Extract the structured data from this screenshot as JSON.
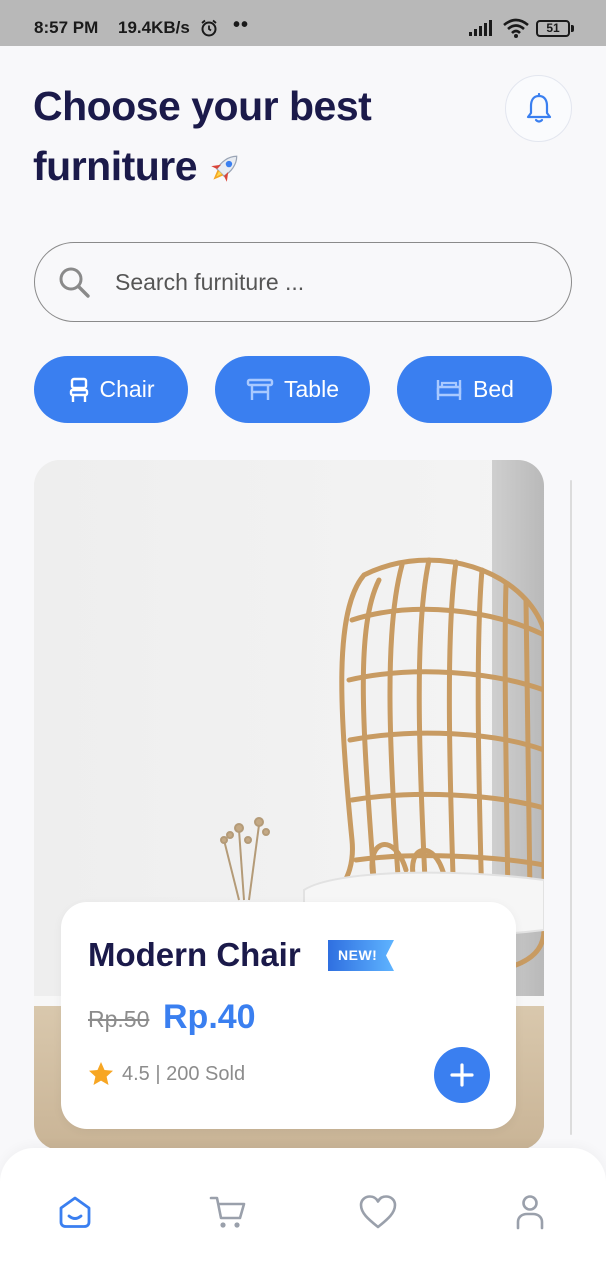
{
  "status_bar": {
    "time": "8:57 PM",
    "net_speed": "19.4KB/s",
    "extra": "••",
    "battery": "51"
  },
  "header": {
    "title": "Choose your best furniture",
    "title_emoji_icon": "rocket-icon",
    "notification_icon": "bell-icon"
  },
  "search": {
    "placeholder": "Search furniture ...",
    "value": ""
  },
  "categories": [
    {
      "label": "Chair",
      "icon": "chair-icon"
    },
    {
      "label": "Table",
      "icon": "table-icon"
    },
    {
      "label": "Bed",
      "icon": "bed-icon"
    }
  ],
  "product": {
    "name": "Modern Chair",
    "badge": "NEW!",
    "old_price": "Rp.50",
    "price": "Rp.40",
    "rating_text": "4.5 | 200 Sold",
    "rating_icon": "star-icon",
    "add_icon": "plus-icon"
  },
  "bottom_nav": [
    {
      "name": "home",
      "icon": "home-icon",
      "active": true
    },
    {
      "name": "cart",
      "icon": "cart-icon",
      "active": false
    },
    {
      "name": "favorites",
      "icon": "heart-icon",
      "active": false
    },
    {
      "name": "profile",
      "icon": "user-icon",
      "active": false
    }
  ],
  "colors": {
    "accent": "#3a7ff0",
    "title": "#1b1a4a",
    "muted": "#8c8c8c",
    "background": "#f8f8fa"
  }
}
